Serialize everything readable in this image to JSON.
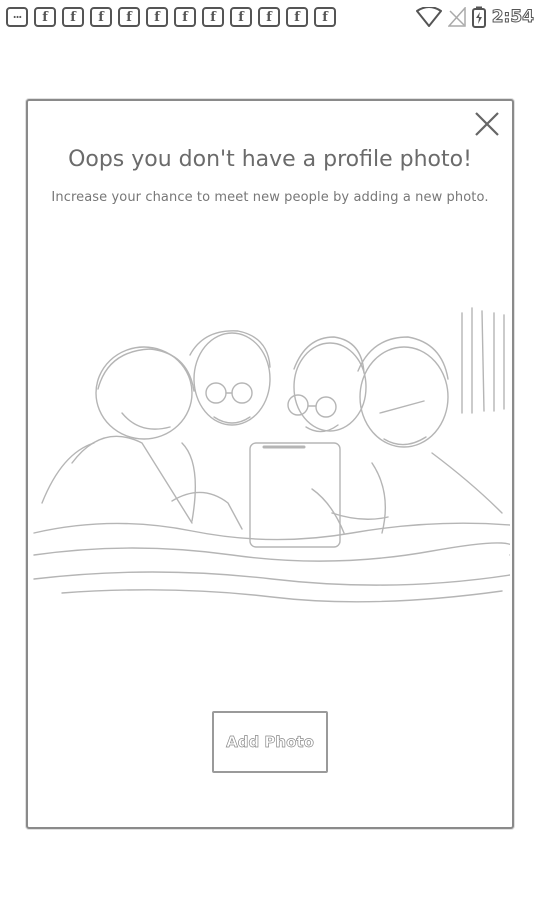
{
  "status_bar": {
    "notification_icons": [
      "more-icon",
      "facebook-icon",
      "facebook-icon",
      "facebook-icon",
      "facebook-icon",
      "facebook-icon",
      "facebook-icon",
      "facebook-icon",
      "facebook-icon",
      "facebook-icon",
      "facebook-icon",
      "facebook-icon"
    ],
    "facebook_glyph": "f",
    "more_glyph": "···",
    "time": "2:54"
  },
  "dialog": {
    "title": "Oops you don't have a profile photo!",
    "subtitle": "Increase your chance to meet new people by adding a new photo.",
    "add_photo_label": "Add Photo"
  }
}
